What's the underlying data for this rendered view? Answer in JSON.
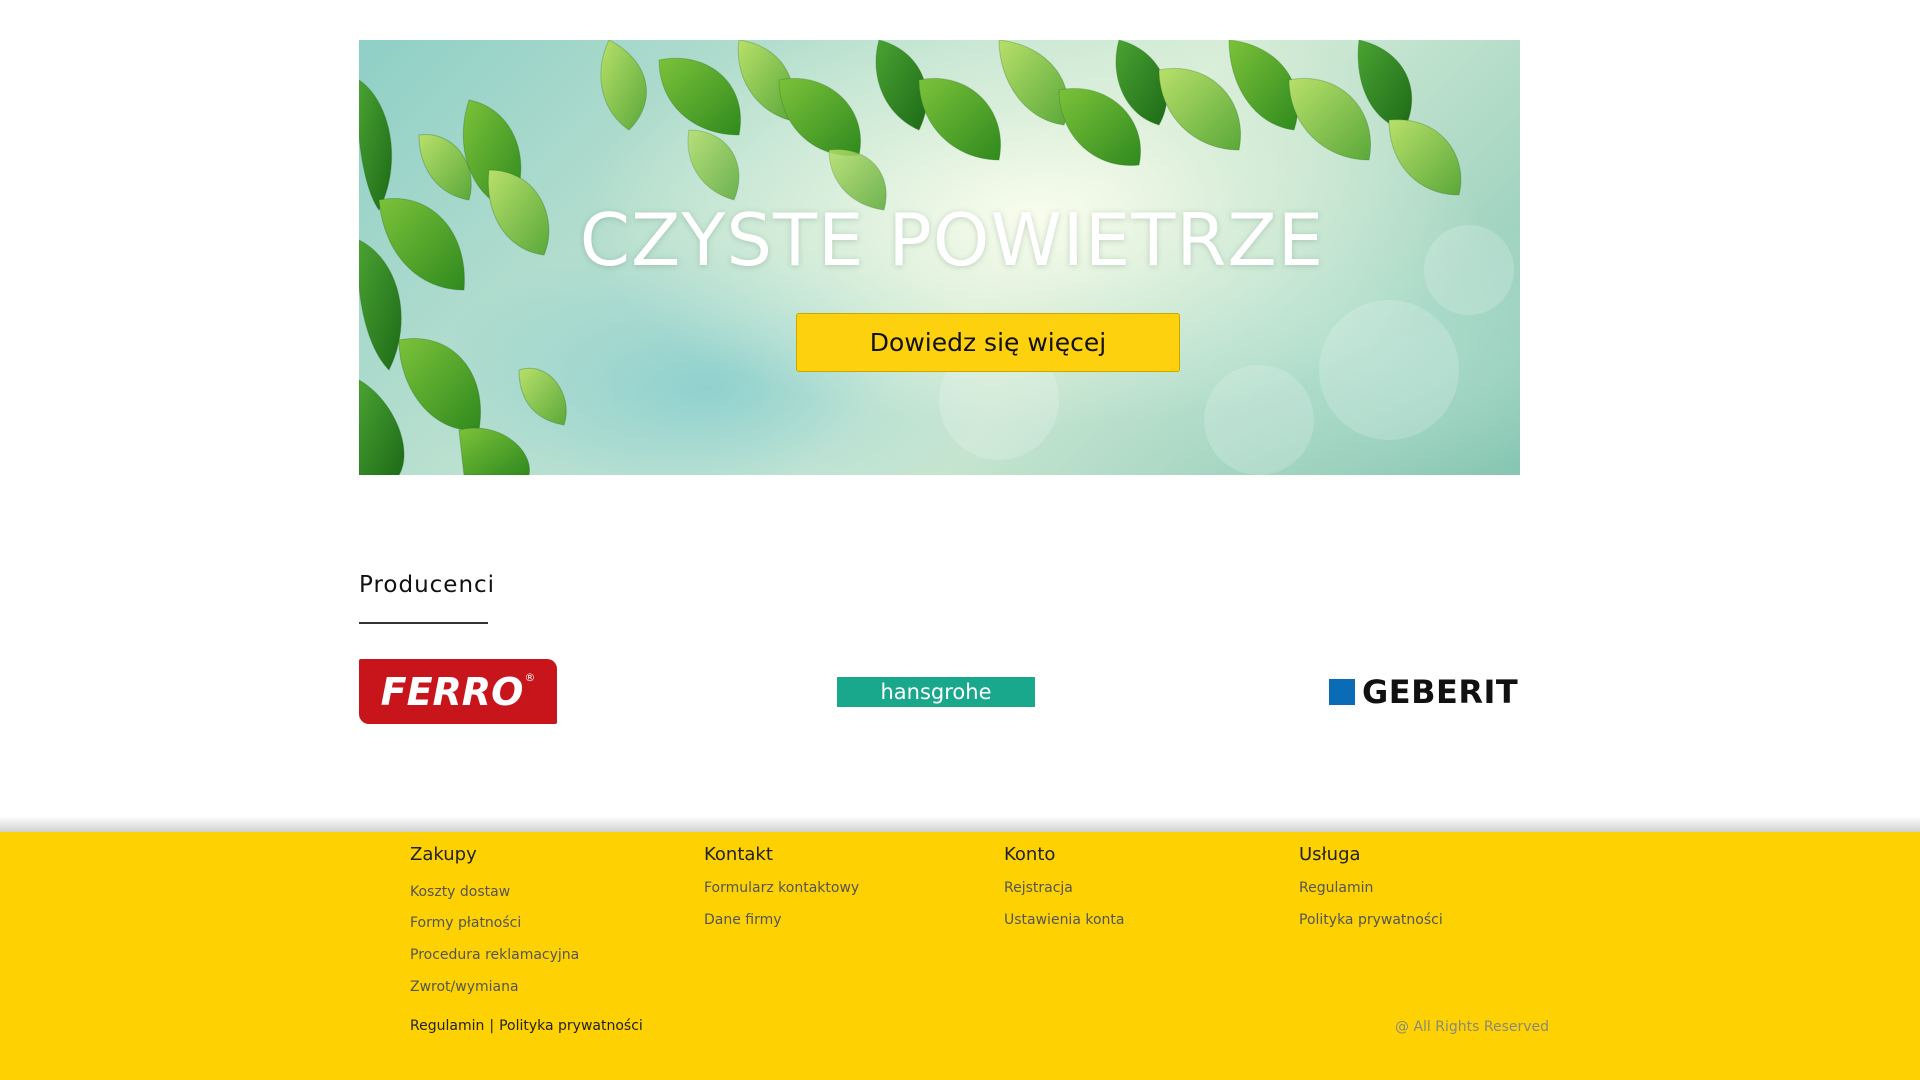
{
  "hero": {
    "title": "CZYSTE POWIETRZE",
    "button_label": "Dowiedz się więcej"
  },
  "producers": {
    "title": "Producenci",
    "logos": [
      {
        "name": "FERRO",
        "mark": "®",
        "color": "#c8151c"
      },
      {
        "name": "hansgrohe",
        "color": "#1aa88c"
      },
      {
        "name": "GEBERIT",
        "color": "#0a6cb4"
      }
    ]
  },
  "footer": {
    "background": "#fdd102",
    "columns": [
      {
        "title": "Zakupy",
        "links": [
          "Koszty dostaw",
          "Formy płatności",
          "Procedura reklamacyjna",
          "Zwrot/wymiana"
        ]
      },
      {
        "title": "Kontakt",
        "links": [
          "Formularz kontaktowy",
          "Dane firmy"
        ]
      },
      {
        "title": "Konto",
        "links": [
          "Rejstracja",
          "Ustawienia konta"
        ]
      },
      {
        "title": "Usługa",
        "links": [
          "Regulamin",
          "Polityka prywatności"
        ]
      }
    ],
    "bottom_links": {
      "regulamin": "Regulamin",
      "separator": "|",
      "privacy": "Polityka prywatności"
    },
    "rights": "@ All Rights Reserved"
  },
  "colors": {
    "accent_yellow": "#fdd10e"
  }
}
